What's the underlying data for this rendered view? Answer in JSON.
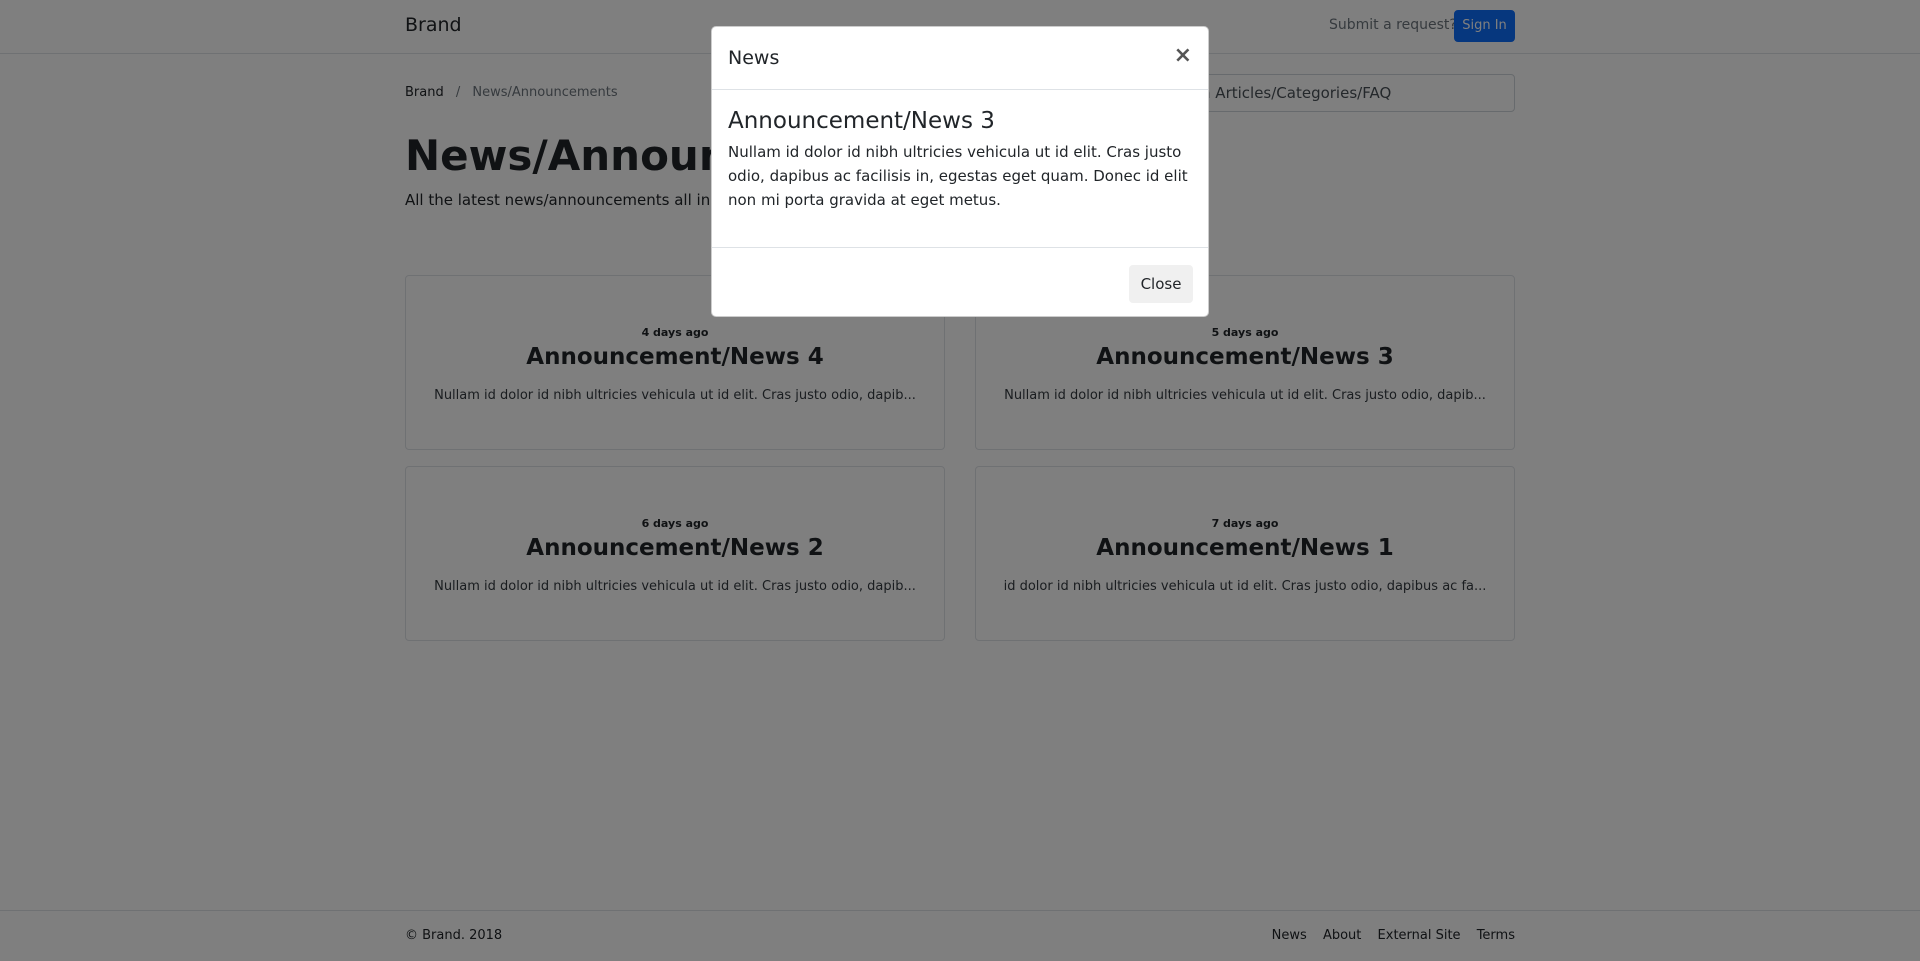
{
  "navbar": {
    "brand": "Brand",
    "submit_request": "Submit a request?",
    "sign_in": "Sign In"
  },
  "breadcrumb": {
    "home": "Brand",
    "separator": "/",
    "current": "News/Announcements"
  },
  "search": {
    "placeholder": "Search Articles/Categories/FAQ"
  },
  "page": {
    "title": "News/Announcements",
    "subtitle": "All the latest news/announcements all in one place."
  },
  "cards": [
    {
      "date": "4 days ago",
      "title": "Announcement/News 4",
      "excerpt": "Nullam id dolor id nibh ultricies vehicula ut id elit. Cras justo odio, dapib..."
    },
    {
      "date": "5 days ago",
      "title": "Announcement/News 3",
      "excerpt": "Nullam id dolor id nibh ultricies vehicula ut id elit. Cras justo odio, dapib..."
    },
    {
      "date": "6 days ago",
      "title": "Announcement/News 2",
      "excerpt": "Nullam id dolor id nibh ultricies vehicula ut id elit. Cras justo odio, dapib..."
    },
    {
      "date": "7 days ago",
      "title": "Announcement/News 1",
      "excerpt": "id dolor id nibh ultricies vehicula ut id elit. Cras justo odio, dapibus ac fa..."
    }
  ],
  "footer": {
    "copyright": "© Brand. 2018",
    "links": [
      "News",
      "About",
      "External Site",
      "Terms"
    ]
  },
  "modal": {
    "header_title": "News",
    "close_symbol": "×",
    "news_title": "Announcement/News 3",
    "news_text": "Nullam id dolor id nibh ultricies vehicula ut id elit. Cras justo odio, dapibus ac facilisis in, egestas eget quam. Donec id elit non mi porta gravida at eget metus.",
    "close_button": "Close"
  },
  "colors": {
    "primary": "#0d6efd",
    "backdrop": "rgba(0,0,0,0.5)"
  }
}
